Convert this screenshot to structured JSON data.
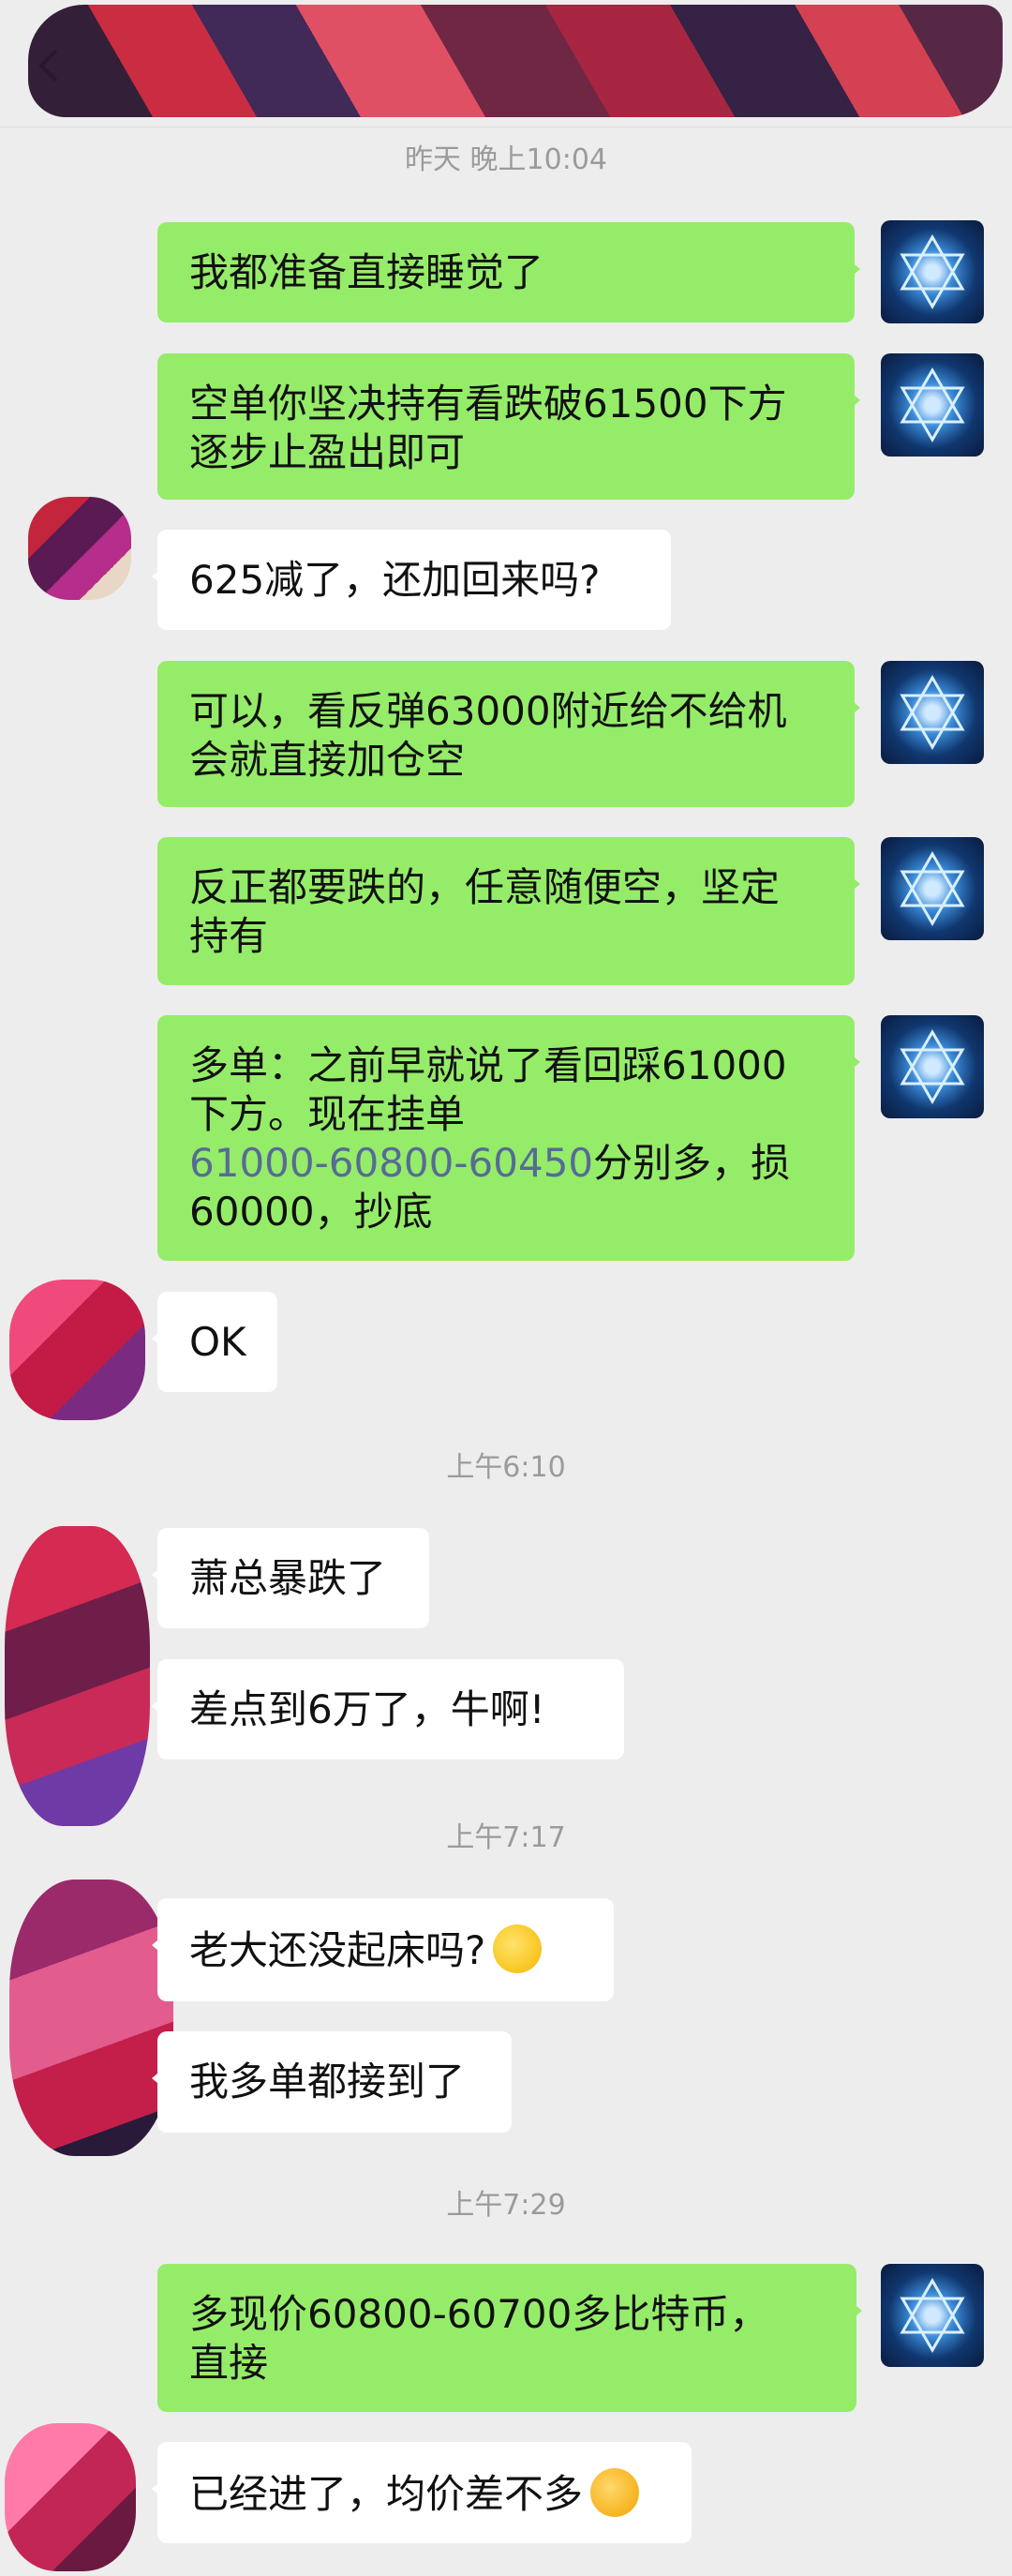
{
  "header": {
    "back_icon": "chevron-left-icon"
  },
  "timestamps": [
    "昨天 晚上10:04",
    "上午6:10",
    "上午7:17",
    "上午7:29"
  ],
  "messages": [
    {
      "side": "me",
      "text": "我都准备直接睡觉了"
    },
    {
      "side": "me",
      "text": "空单你坚决持有看跌破61500下方\n逐步止盈出即可"
    },
    {
      "side": "other",
      "text": "625减了，还加回来吗?"
    },
    {
      "side": "me",
      "text": "可以，看反弹63000附近给不给机\n会就直接加仓空"
    },
    {
      "side": "me",
      "text": "反正都要跌的，任意随便空，坚定\n持有"
    },
    {
      "side": "me",
      "text_a": "多单：之前早就说了看回踩61000\n下方。现在挂单\n",
      "link": "61000-60800-60450",
      "text_b": "分别多，损\n60000，抄底"
    },
    {
      "side": "other",
      "text": "OK"
    },
    {
      "side": "other",
      "text": "萧总暴跌了"
    },
    {
      "side": "other",
      "text": "差点到6万了，牛啊!"
    },
    {
      "side": "other",
      "text": "老大还没起床吗?",
      "emoji": "thinking-face-icon"
    },
    {
      "side": "other",
      "text": "我多单都接到了"
    },
    {
      "side": "me",
      "text": "多现价60800-60700多比特币，\n直接"
    },
    {
      "side": "other",
      "text": "已经进了，均价差不多",
      "emoji": "heart-eyes-face-icon"
    }
  ],
  "colors": {
    "background": "#ededed",
    "me_bubble": "#95ec69",
    "other_bubble": "#ffffff",
    "timestamp": "#9b9b9b",
    "link": "#576b95"
  }
}
